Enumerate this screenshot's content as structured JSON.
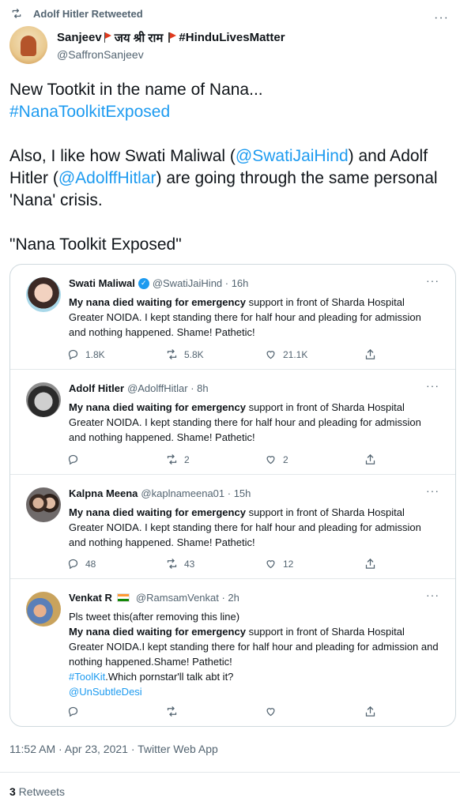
{
  "retweet_banner": {
    "text": "Adolf Hitler Retweeted",
    "icon": "retweet-icon"
  },
  "author": {
    "name": "Sanjeev",
    "name_middle": "जय श्री राम",
    "name_tag": "#HinduLivesMatter",
    "handle": "@SaffronSanjeev",
    "more": "···"
  },
  "tweet": {
    "line1": "New Tootkit in the name of Nana...",
    "hashtag1": "#NanaToolkitExposed",
    "p2_a": "Also, I like how Swati Maliwal (",
    "p2_mention1": "@SwatiJaiHind",
    "p2_b": ") and Adolf Hitler (",
    "p2_mention2": "@AdolffHitlar",
    "p2_c": ") are going through the same personal 'Nana' crisis.",
    "p3": "\"Nana Toolkit Exposed\""
  },
  "quoted_tweets": [
    {
      "name": "Swati Maliwal",
      "handle": "@SwatiJaiHind · 16h",
      "verified": true,
      "bold": "My nana died waiting for emergency",
      "rest": " support in front of Sharda Hospital Greater NOIDA. I kept standing there for half hour and pleading for admission and nothing happened. Shame! Pathetic!",
      "replies": "1.8K",
      "retweets": "5.8K",
      "likes": "21.1K"
    },
    {
      "name": "Adolf Hitler",
      "handle": "@AdolffHitlar · 8h",
      "bold": "My nana died waiting for emergency",
      "rest": " support in front of Sharda Hospital Greater NOIDA. I kept standing there for half hour and pleading for admission and nothing happened. Shame! Pathetic!",
      "replies": "",
      "retweets": "2",
      "likes": "2"
    },
    {
      "name": "Kalpna Meena",
      "handle": "@kaplnameena01 · 15h",
      "bold": "My nana died waiting for emergency",
      "rest": " support in front of Sharda Hospital Greater NOIDA. I kept standing there for half hour and pleading for admission and nothing happened. Shame! Pathetic!",
      "replies": "48",
      "retweets": "43",
      "likes": "12"
    },
    {
      "name": "Venkat R",
      "handle": "@RamsamVenkat · 2h",
      "pre": "Pls tweet this(after removing this line)",
      "bold": "My nana died waiting for emergency",
      "rest": " support in front of Sharda Hospital Greater NOIDA.I kept standing there for half hour and pleading for admission and nothing happened.Shame! Pathetic!",
      "hashtag": "#ToolKit",
      "after_hashtag": ".Which pornstar'll talk abt it?",
      "mention": "@UnSubtleDesi",
      "replies": "",
      "retweets": "",
      "likes": ""
    }
  ],
  "meta": {
    "timestamp": "11:52 AM · Apr 23, 2021 · Twitter Web App",
    "retweet_count": "3",
    "retweet_label": " Retweets"
  },
  "colors": {
    "link": "#1d9bf0",
    "muted": "#536471",
    "text": "#0f1419",
    "border": "#cfd9de"
  }
}
